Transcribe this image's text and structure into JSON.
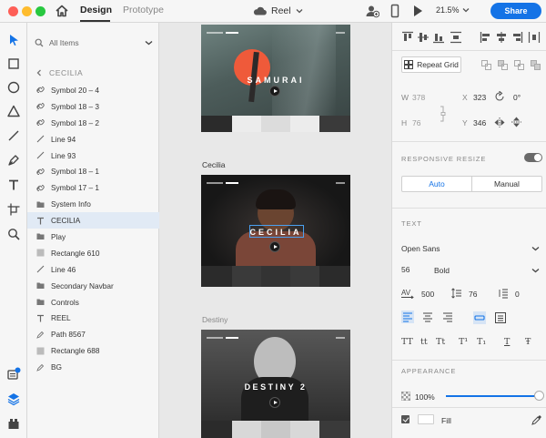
{
  "topbar": {
    "tab_design": "Design",
    "tab_prototype": "Prototype",
    "doc_title": "Reel",
    "zoom": "21.5%",
    "share": "Share"
  },
  "layers": {
    "search_label": "All Items",
    "breadcrumb": "CECILIA",
    "items": [
      {
        "label": "Symbol 20 – 4",
        "icon": "symbol-icon"
      },
      {
        "label": "Symbol 18 – 3",
        "icon": "symbol-icon"
      },
      {
        "label": "Symbol 18 – 2",
        "icon": "symbol-icon"
      },
      {
        "label": "Line 94",
        "icon": "line-icon"
      },
      {
        "label": "Line 93",
        "icon": "line-icon"
      },
      {
        "label": "Symbol 18 – 1",
        "icon": "symbol-icon"
      },
      {
        "label": "Symbol 17 – 1",
        "icon": "symbol-icon"
      },
      {
        "label": "System Info",
        "icon": "folder-icon"
      },
      {
        "label": "CECILIA",
        "icon": "text-icon",
        "selected": true
      },
      {
        "label": "Play",
        "icon": "folder-icon"
      },
      {
        "label": "Rectangle 610",
        "icon": "rectangle-icon"
      },
      {
        "label": "Line 46",
        "icon": "line-icon"
      },
      {
        "label": "Secondary Navbar",
        "icon": "folder-icon"
      },
      {
        "label": "Controls",
        "icon": "folder-icon"
      },
      {
        "label": "REEL",
        "icon": "text-icon"
      },
      {
        "label": "Path 8567",
        "icon": "path-icon"
      },
      {
        "label": "Rectangle 688",
        "icon": "rectangle-icon"
      },
      {
        "label": "BG",
        "icon": "path-icon"
      }
    ]
  },
  "canvas": {
    "artboard1_title": "SAMURAI",
    "artboard2_label": "Cecilia",
    "artboard2_title": "CECILIA",
    "artboard3_label": "Destiny",
    "artboard3_title": "DESTINY 2"
  },
  "inspector": {
    "repeat_grid": "Repeat Grid",
    "w_label": "W",
    "w_value": "378",
    "h_label": "H",
    "h_value": "76",
    "x_label": "X",
    "x_value": "323",
    "y_label": "Y",
    "y_value": "346",
    "rotation": "0°",
    "responsive_title": "RESPONSIVE RESIZE",
    "auto": "Auto",
    "manual": "Manual",
    "text_title": "TEXT",
    "font_family": "Open Sans",
    "font_size": "56",
    "font_weight": "Bold",
    "char_spacing": "500",
    "line_height": "76",
    "para_spacing": "0",
    "text_styles": [
      "TT",
      "tt",
      "Tt",
      "T¹",
      "T₁",
      "T",
      "Ŧ"
    ],
    "appearance_title": "APPEARANCE",
    "opacity": "100%",
    "opacity_fraction": 1.0,
    "fill_label": "Fill"
  },
  "colors": {
    "accent": "#1473e6",
    "samurai_sun": "#ef5a3a"
  }
}
